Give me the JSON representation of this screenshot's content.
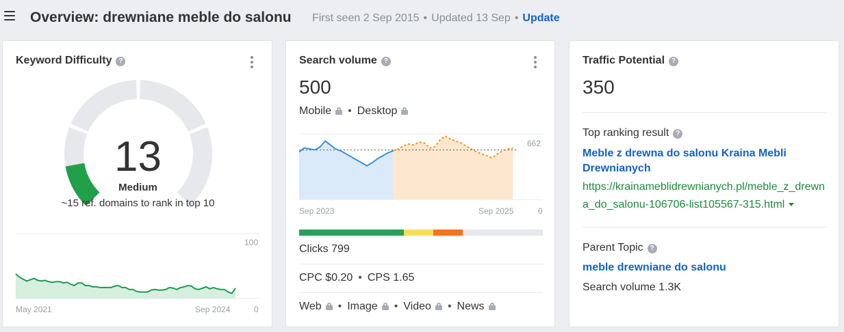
{
  "header": {
    "title": "Overview: drewniane meble do salonu",
    "first_seen": "First seen 2 Sep 2015",
    "updated": "Updated 13 Sep",
    "update_label": "Update"
  },
  "keyword_difficulty": {
    "title": "Keyword Difficulty",
    "value": "13",
    "level": "Medium",
    "note": "~15 ref. domains to rank in top 10",
    "gauge_fraction": 0.13,
    "trend": {
      "y_max": "100",
      "y_min": "0",
      "x_start": "May 2021",
      "x_end": "Sep 2024",
      "values": [
        38,
        33,
        30,
        27,
        29,
        31,
        28,
        27,
        28,
        26,
        25,
        26,
        26,
        24,
        25,
        22,
        20,
        24,
        24,
        20,
        20,
        18,
        18,
        17,
        17,
        17,
        17,
        19,
        20,
        17,
        17,
        14,
        14,
        11,
        10,
        10,
        10,
        13,
        14,
        13,
        13,
        14,
        17,
        16,
        14,
        17,
        18,
        20,
        19,
        15,
        14,
        16,
        18,
        15,
        17,
        15,
        14,
        14,
        10,
        8,
        16
      ]
    }
  },
  "search_volume": {
    "title": "Search volume",
    "value": "500",
    "mobile_label": "Mobile",
    "desktop_label": "Desktop",
    "chart": {
      "y_max": "662",
      "y_min": "0",
      "x_start": "Sep 2023",
      "x_end": "Sep 2025",
      "reference_value": 500,
      "y_range": [
        0,
        662
      ],
      "history": [
        480,
        520,
        510,
        500,
        530,
        590,
        550,
        510,
        490,
        460,
        430,
        400,
        370,
        340,
        370,
        410,
        440,
        470,
        490
      ],
      "forecast": [
        490,
        510,
        540,
        560,
        550,
        580,
        570,
        520,
        530,
        600,
        640,
        610,
        590,
        570,
        540,
        510,
        480,
        460,
        440,
        420,
        460,
        490,
        510,
        520
      ]
    },
    "distribution": [
      {
        "color": "#2aa05a",
        "share": 0.43
      },
      {
        "color": "#f7dd58",
        "share": 0.12
      },
      {
        "color": "#f5741f",
        "share": 0.12
      },
      {
        "color": "#e6e8eb",
        "share": 0.33
      }
    ],
    "clicks": "Clicks 799",
    "cpc": "CPC $0.20",
    "cps": "CPS 1.65",
    "serp_types": [
      "Web",
      "Image",
      "Video",
      "News"
    ]
  },
  "traffic_potential": {
    "title": "Traffic Potential",
    "value": "350",
    "top_result_label": "Top ranking result",
    "top_result_title": "Meble z drewna do salonu Kraina Mebli Drewnianych",
    "top_result_url": "https://krainameblidrewnianych.pl/meble_z_drewna_do_salonu-106706-list105567-315.html",
    "parent_topic_label": "Parent Topic",
    "parent_topic": "meble drewniane do salonu",
    "parent_volume": "Search volume 1.3K"
  },
  "colors": {
    "link": "#1463c4",
    "url": "#1e8a3c",
    "gauge_fill": "#21a04a",
    "gauge_track": "#e6e8eb",
    "history_line": "#3d8fdb",
    "forecast_line": "#f4951e"
  },
  "icons": {
    "menu": "hamburger-icon",
    "help": "question-circle-icon",
    "more": "kebab-icon",
    "lock": "lock-icon",
    "caret": "caret-down-icon"
  }
}
